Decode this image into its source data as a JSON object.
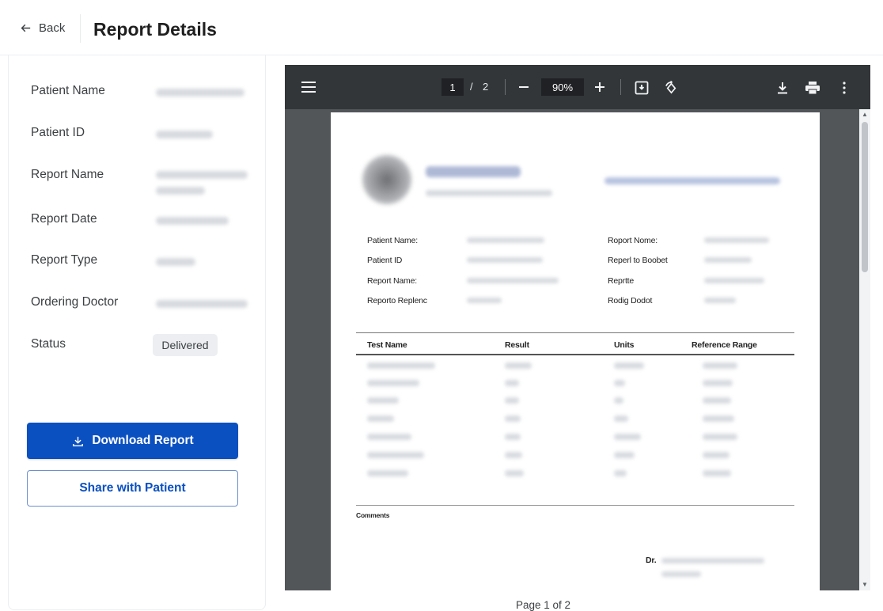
{
  "header": {
    "back_label": "Back",
    "title": "Report Details"
  },
  "details": {
    "fields": [
      {
        "label": "Patient Name"
      },
      {
        "label": "Patient ID"
      },
      {
        "label": "Report Name"
      },
      {
        "label": "Report Date"
      },
      {
        "label": "Report Type"
      },
      {
        "label": "Ordering Doctor"
      },
      {
        "label": "Status",
        "value": "Delivered"
      }
    ]
  },
  "actions": {
    "download_label": "Download Report",
    "share_label": "Share with Patient"
  },
  "viewer": {
    "current_page": "1",
    "page_separator": "/",
    "total_pages": "2",
    "zoom": "90%",
    "icons": [
      "menu-icon",
      "zoom-out-icon",
      "zoom-in-icon",
      "fit-page-icon",
      "rotate-icon",
      "download-icon",
      "print-icon",
      "more-vert-icon"
    ]
  },
  "document": {
    "meta_left": [
      "Patient Name:",
      "Patient ID",
      "Report Name:",
      "Reporto Replenc"
    ],
    "meta_right": [
      "Roport Nome:",
      "Reperl to Boobet",
      "Reprtte",
      "Rodig Dodot"
    ],
    "table_headers": [
      "Test Name",
      "Result",
      "Units",
      "Reference Range"
    ],
    "comments_label": "Comments",
    "signature_prefix": "Dr."
  },
  "footer": {
    "page_indicator": "Page 1 of 2"
  }
}
